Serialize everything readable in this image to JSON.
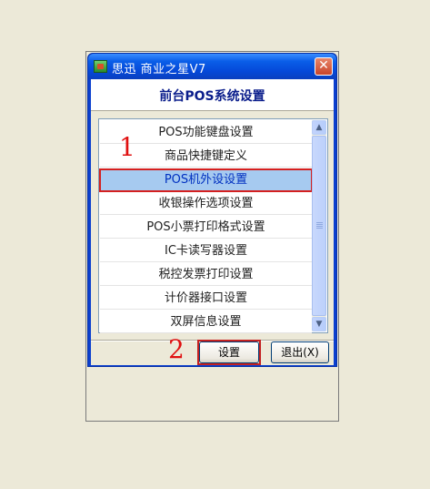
{
  "window": {
    "title": "思迅  商业之星V7",
    "close_glyph": "✕"
  },
  "header": {
    "title": "前台POS系统设置"
  },
  "menu": {
    "items": [
      {
        "label": "POS功能键盘设置",
        "selected": false
      },
      {
        "label": "商品快捷键定义",
        "selected": false
      },
      {
        "label": "POS机外设设置",
        "selected": true
      },
      {
        "label": "收银操作选项设置",
        "selected": false
      },
      {
        "label": "POS小票打印格式设置",
        "selected": false
      },
      {
        "label": "IC卡读写器设置",
        "selected": false
      },
      {
        "label": "税控发票打印设置",
        "selected": false
      },
      {
        "label": "计价器接口设置",
        "selected": false
      },
      {
        "label": "双屏信息设置",
        "selected": false
      }
    ]
  },
  "scrollbar": {
    "up_glyph": "▲",
    "down_glyph": "▼"
  },
  "buttons": {
    "settings": "设置",
    "exit": "退出(X)"
  },
  "annotations": {
    "step1": "1",
    "step2": "2"
  },
  "colors": {
    "titlebar": "#0a5ee8",
    "selection": "#a6caf0",
    "annotation": "#e01010",
    "header_text": "#0b1e8c"
  }
}
